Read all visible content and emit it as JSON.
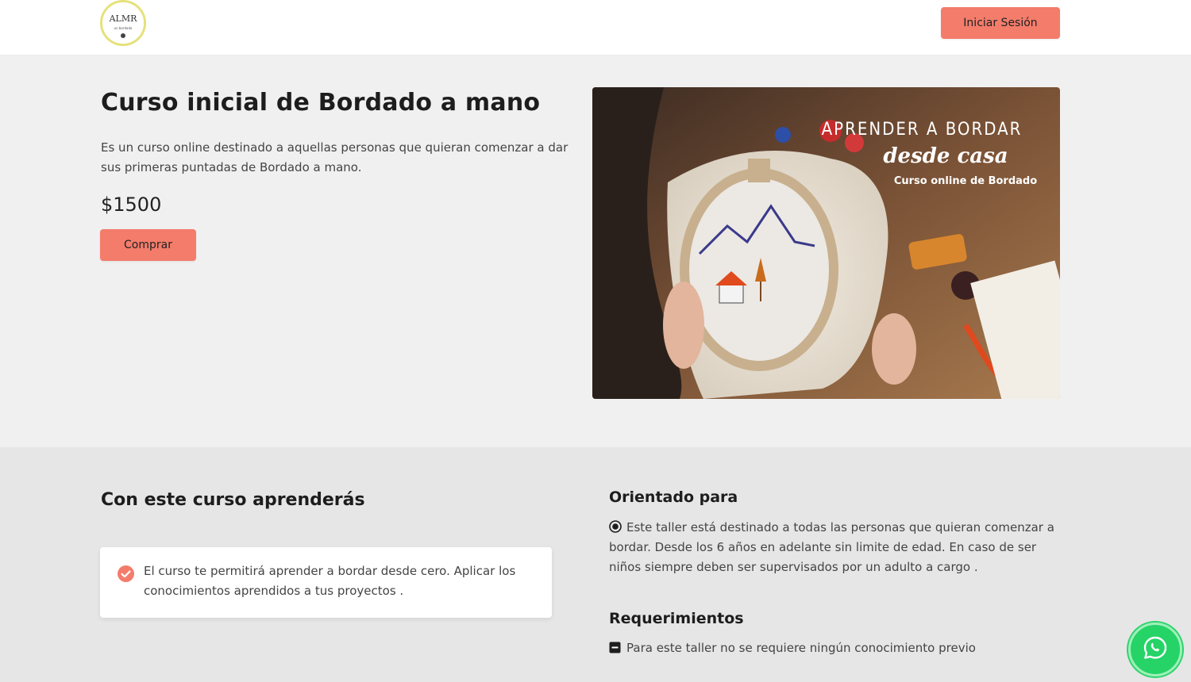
{
  "header": {
    "logo_text": "ALMR",
    "logo_subtext": "un bordado",
    "login_label": "Iniciar Sesión"
  },
  "hero": {
    "title": "Curso inicial de Bordado a mano",
    "description": "Es un curso online destinado a aquellas personas que quieran comenzar a dar sus primeras puntadas de Bordado a mano.",
    "price": "$1500",
    "buy_label": "Comprar",
    "image": {
      "line1": "APRENDER A BORDAR",
      "line2": "desde casa",
      "line3": "Curso online de Bordado"
    }
  },
  "learn": {
    "title": "Con este curso aprenderás",
    "items": [
      {
        "text": "El curso te permitirá aprender a bordar desde cero. Aplicar los conocimientos aprendidos a tus proyectos ."
      }
    ]
  },
  "orientado": {
    "title": "Orientado para",
    "text": "Este taller está destinado a todas las personas que quieran comenzar a bordar. Desde los 6 años en adelante sin limite de edad. En caso de ser niños siempre deben ser supervisados por un adulto a cargo ."
  },
  "requerimientos": {
    "title": "Requerimientos",
    "text": "Para este taller no se requiere ningún conocimiento previo"
  },
  "icons": {
    "check": "check-circle-icon",
    "radio": "radio-selected-icon",
    "minus": "minus-square-icon",
    "whatsapp": "whatsapp-icon"
  },
  "colors": {
    "accent": "#f47c6b",
    "hero_bg": "#f0f0f0",
    "lower_bg": "#e6e6e6",
    "whatsapp": "#25d366"
  }
}
